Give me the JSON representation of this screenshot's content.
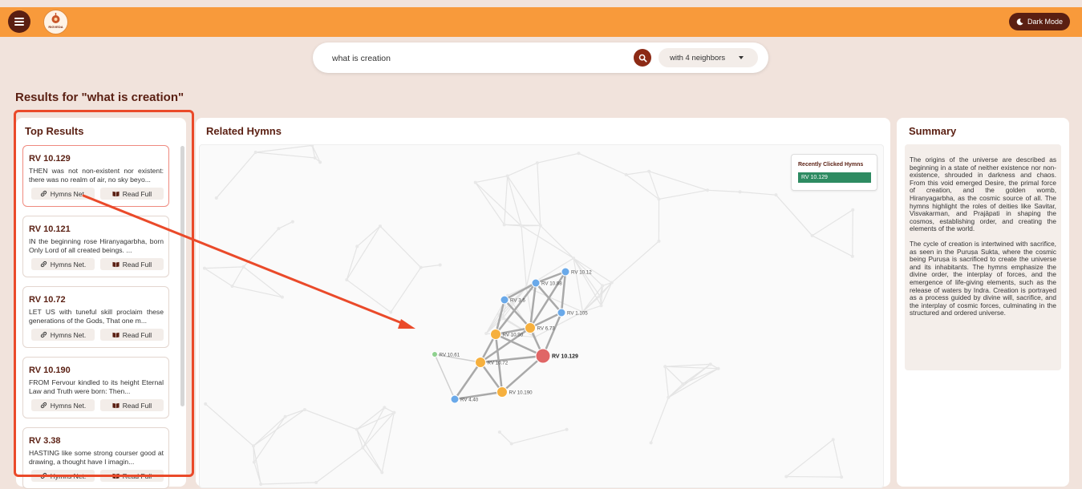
{
  "header": {
    "logo_text": "RIGVEDA",
    "dark_mode_label": "Dark Mode"
  },
  "search": {
    "query": "what is creation",
    "neighbors_selected": "with 4 neighbors"
  },
  "results_heading": "Results for \"what is creation\"",
  "top_results": {
    "title": "Top Results",
    "hymns_net_label": "Hymns Net.",
    "read_full_label": "Read Full",
    "items": [
      {
        "id": "RV 10.129",
        "text": "THEN was not non-existent nor existent: there was no realm of air, no sky beyo..."
      },
      {
        "id": "RV 10.121",
        "text": "IN the beginning rose Hiranyagarbha, born Only Lord of all created beings. ..."
      },
      {
        "id": "RV 10.72",
        "text": "LET US with tuneful skill proclaim these generations of the Gods, That one m..."
      },
      {
        "id": "RV 10.190",
        "text": "FROM Fervour kindled to its height Eternal Law and Truth were born: Then..."
      },
      {
        "id": "RV 3.38",
        "text": "HASTING like some strong courser good at drawing, a thought have I imagin..."
      }
    ]
  },
  "related": {
    "title": "Related Hymns",
    "recent_title": "Recently Clicked Hymns",
    "recent_items": [
      "RV 10.129"
    ],
    "nodes": [
      {
        "id": "RV 10.129",
        "group": "center",
        "color": "#e06666"
      },
      {
        "id": "RV 10.12",
        "group": "blue",
        "color": "#6aa9e9"
      },
      {
        "id": "RV 10.88",
        "group": "blue",
        "color": "#6aa9e9"
      },
      {
        "id": "RV 3.6",
        "group": "blue",
        "color": "#6aa9e9"
      },
      {
        "id": "RV 1.105",
        "group": "blue",
        "color": "#6aa9e9"
      },
      {
        "id": "RV 6.73",
        "group": "orange",
        "color": "#f6b03e"
      },
      {
        "id": "RV 10.90",
        "group": "orange",
        "color": "#f6b03e"
      },
      {
        "id": "RV 10.72",
        "group": "orange",
        "color": "#f6b03e"
      },
      {
        "id": "RV 10.190",
        "group": "orange",
        "color": "#f6b03e"
      },
      {
        "id": "RV 4.40",
        "group": "blue",
        "color": "#6aa9e9"
      },
      {
        "id": "RV 10.61",
        "group": "green",
        "color": "#8fd18f"
      }
    ]
  },
  "summary": {
    "title": "Summary",
    "p1": "The origins of the universe are described as beginning in a state of neither existence nor non-existence, shrouded in darkness and chaos. From this void emerged Desire, the primal force of creation, and the golden womb, Hiranyagarbha, as the cosmic source of all. The hymns highlight the roles of deities like Savitar, Visvakarman, and Prajāpati in shaping the cosmos, establishing order, and creating the elements of the world.",
    "p2": "The cycle of creation is intertwined with sacrifice, as seen in the Puruṣa Sukta, where the cosmic being Puruṣa is sacrificed to create the universe and its inhabitants. The hymns emphasize the divine order, the interplay of forces, and the emergence of life-giving elements, such as the release of waters by Indra. Creation is portrayed as a process guided by divine will, sacrifice, and the interplay of cosmic forces, culminating in the structured and ordered universe."
  },
  "colors": {
    "header": "#f89a3b",
    "brand_dark": "#5a1f12",
    "annotation": "#ea4a2a",
    "recent_green": "#2e8b62"
  }
}
